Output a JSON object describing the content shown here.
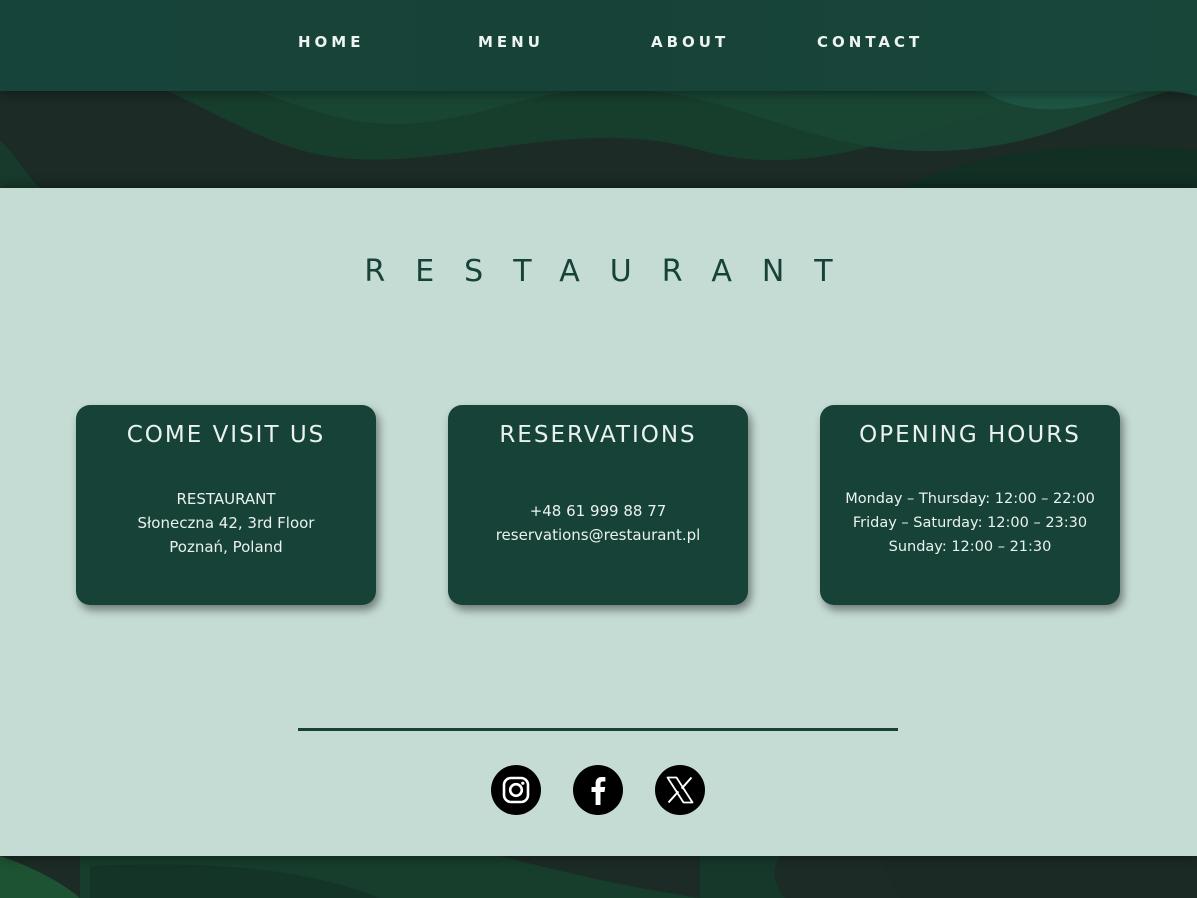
{
  "nav": {
    "home": "HOME",
    "menu": "MENU",
    "about": "ABOUT",
    "contact": "CONTACT"
  },
  "site_title": "RESTAURANT",
  "cards": {
    "visit": {
      "title": "COME VISIT US",
      "lines": [
        "RESTAURANT",
        "Słoneczna 42, 3rd Floor",
        "Poznań, Poland"
      ]
    },
    "reservations": {
      "title": "RESERVATIONS",
      "lines": [
        "+48 61 999 88 77",
        "reservations@restaurant.pl"
      ]
    },
    "hours": {
      "title": "OPENING HOURS",
      "lines": [
        "Monday – Thursday: 12:00 – 22:00",
        "Friday – Saturday: 12:00 – 23:30",
        "Sunday: 12:00 – 21:30"
      ]
    }
  },
  "social": {
    "instagram": "instagram-icon",
    "facebook": "facebook-icon",
    "x": "x-icon"
  },
  "colors": {
    "dark_green": "#174238",
    "mint_background": "#c5dcd4",
    "nav_text": "#eef4f1"
  }
}
